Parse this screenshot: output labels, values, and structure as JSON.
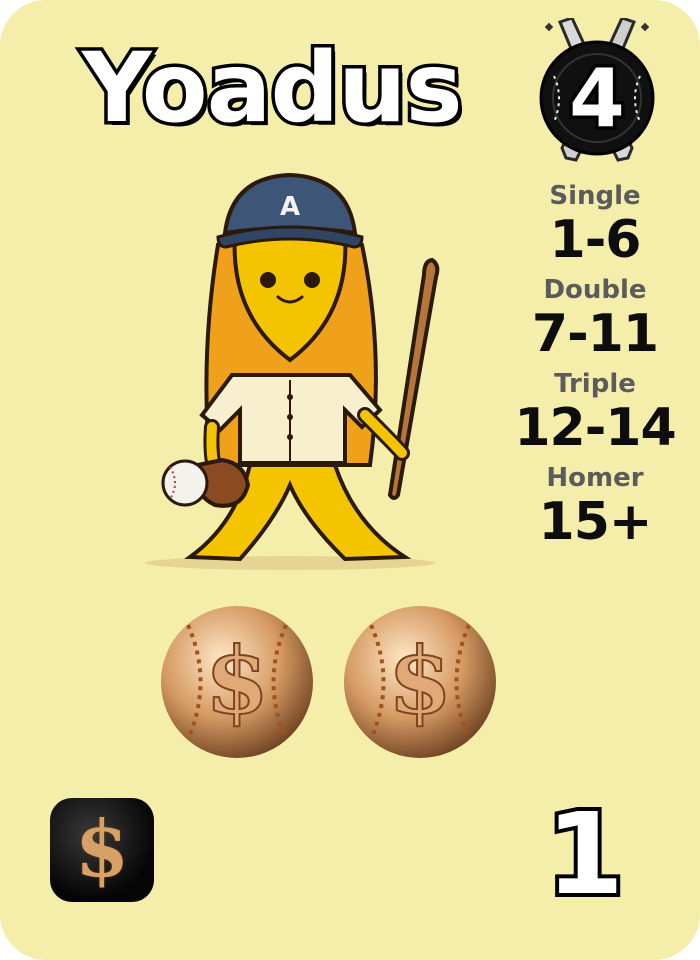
{
  "card": {
    "name": "Yoadus",
    "cost": "4",
    "cap_letter": "A",
    "power": "1",
    "outcomes": [
      {
        "label": "Single",
        "range": "1-6"
      },
      {
        "label": "Double",
        "range": "7-11"
      },
      {
        "label": "Triple",
        "range": "12-14"
      },
      {
        "label": "Homer",
        "range": "15+"
      }
    ],
    "coin_symbol": "$",
    "coins": 2,
    "badge_symbol": "$"
  },
  "icons": {
    "cost": "crossed-bats-baseball-icon",
    "coin": "dollar-baseball-coin-icon",
    "badge": "dollar-badge-icon",
    "character": "yellow-baseball-player-illustration"
  },
  "colors": {
    "card_background": "#f5eeab",
    "stat_label": "#5b5b5b",
    "stat_value": "#0d0d0d",
    "cap": "#3d5678",
    "character": "#f5c400",
    "coin": "#c98a52"
  }
}
